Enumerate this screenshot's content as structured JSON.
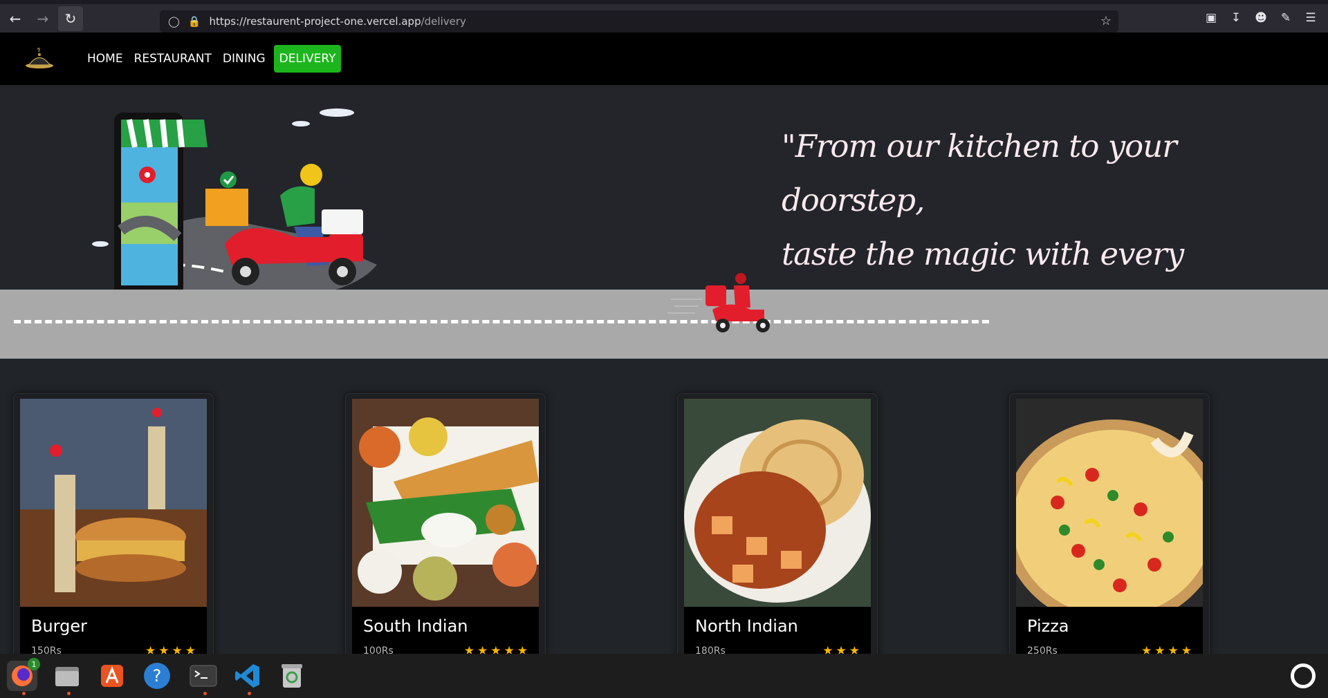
{
  "browser": {
    "url_domain": "https://restaurent-project-one.vercel.app",
    "url_path": "/delivery"
  },
  "nav": {
    "items": [
      {
        "label": "HOME"
      },
      {
        "label": "RESTAURANT"
      },
      {
        "label": "DINING"
      },
      {
        "label": "DELIVERY",
        "active": true
      }
    ]
  },
  "hero": {
    "quote_line1": "\"From our kitchen to your doorstep,",
    "quote_line2": "taste the magic with every bite!\""
  },
  "cards": [
    {
      "title": "Burger",
      "price": "150Rs",
      "stars": 4
    },
    {
      "title": "South Indian",
      "price": "100Rs",
      "stars": 5
    },
    {
      "title": "North Indian",
      "price": "180Rs",
      "stars": 3
    },
    {
      "title": "Pizza",
      "price": "250Rs",
      "stars": 4
    }
  ],
  "taskbar": {
    "firefox_badge": "1"
  },
  "colors": {
    "accent": "#1db51d",
    "star": "#f7b500"
  }
}
